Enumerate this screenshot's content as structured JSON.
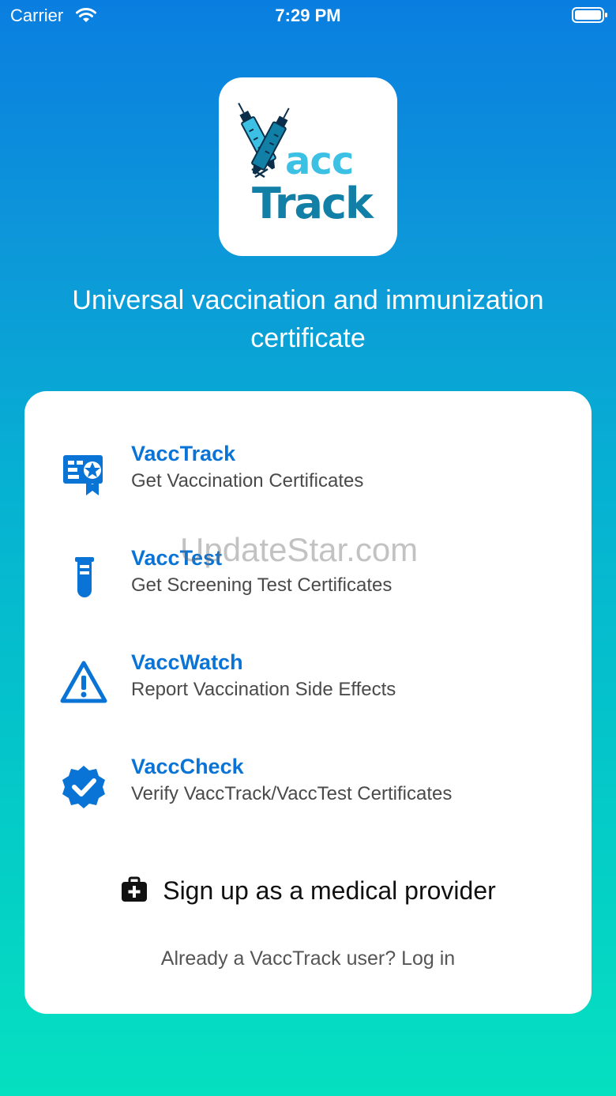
{
  "status_bar": {
    "carrier": "Carrier",
    "time": "7:29 PM",
    "icons": [
      "wifi-icon",
      "battery-icon"
    ]
  },
  "logo": {
    "line1": "acc",
    "line2": "Track",
    "colors": {
      "light": "#3cc0e3",
      "dark": "#127fa6",
      "ink": "#0b2f4a"
    }
  },
  "tagline": "Universal vaccination and immunization certificate",
  "features": [
    {
      "icon": "certificate-badge-icon",
      "title": "VaccTrack",
      "subtitle": "Get Vaccination Certificates"
    },
    {
      "icon": "test-tube-icon",
      "title": "VaccTest",
      "subtitle": "Get Screening Test Certificates"
    },
    {
      "icon": "warning-triangle-icon",
      "title": "VaccWatch",
      "subtitle": "Report Vaccination Side Effects"
    },
    {
      "icon": "verified-badge-icon",
      "title": "VaccCheck",
      "subtitle": "Verify VaccTrack/VaccTest Certificates"
    }
  ],
  "signup": {
    "icon": "medical-kit-icon",
    "label": "Sign up as a medical provider"
  },
  "login_prompt": "Already a VaccTrack user? Log in",
  "watermark": "UpdateStar.com",
  "colors": {
    "accent": "#0a74d6",
    "gradient_top": "#0a7ee0",
    "gradient_bottom": "#05e0c0"
  }
}
